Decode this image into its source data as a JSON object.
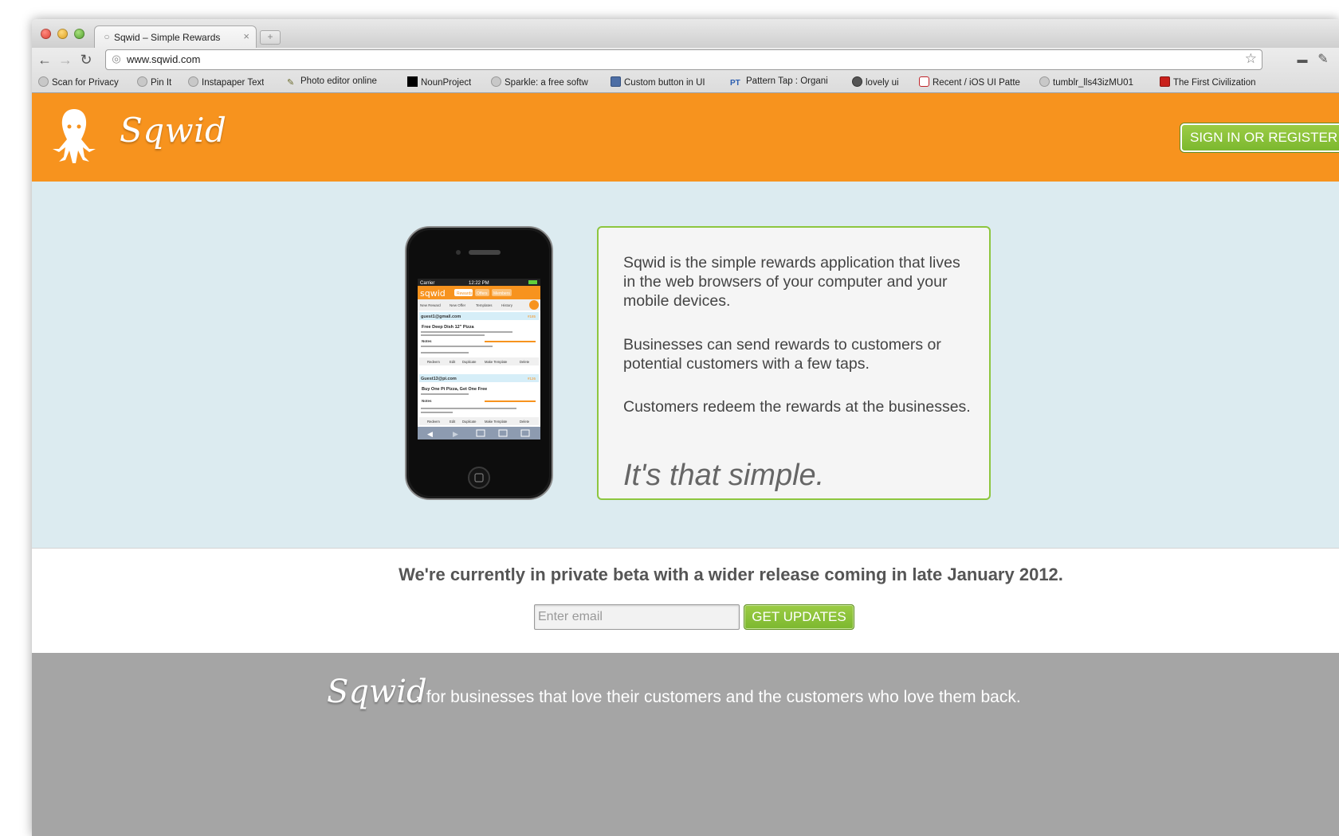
{
  "browser": {
    "tab_title": "Sqwid – Simple Rewards",
    "tab_close": "×",
    "new_tab": "+",
    "url": "www.sqwid.com",
    "bookmarks": [
      {
        "label": "Scan for Privacy",
        "icon": "globe-icon"
      },
      {
        "label": "Pin It",
        "icon": "globe-icon"
      },
      {
        "label": "Instapaper Text",
        "icon": "globe-icon"
      },
      {
        "label": "Photo editor online",
        "icon": "pencil-icon"
      },
      {
        "label": "NounProject",
        "icon": "black-square-icon"
      },
      {
        "label": "Sparkle: a free softw",
        "icon": "globe-icon"
      },
      {
        "label": "Custom button in UI",
        "icon": "image-icon"
      },
      {
        "label": "Pattern Tap : Organi",
        "icon": "pt-icon"
      },
      {
        "label": "lovely ui",
        "icon": "heart-icon"
      },
      {
        "label": "Recent / iOS UI Patte",
        "icon": "pinterest-icon"
      },
      {
        "label": "tumblr_lls43izMU01",
        "icon": "globe-icon"
      },
      {
        "label": "The First Civilization",
        "icon": "mcgraw-icon"
      }
    ]
  },
  "header": {
    "logo_text": "Sqwid",
    "signin_label": "SIGN IN OR REGISTER"
  },
  "hero": {
    "paragraph1": "Sqwid is the simple rewards application that lives in the web browsers of your computer and your mobile devices.",
    "paragraph2": "Businesses can send rewards to customers or potential customers with a few taps.",
    "paragraph3": "Customers redeem the rewards at the businesses.",
    "tagline": "It's that simple.",
    "phone": {
      "carrier": "Carrier",
      "time": "12:22 PM",
      "app_logo": "sqwid",
      "tabs": [
        "Rewards",
        "Offers",
        "Members"
      ],
      "subtabs": [
        "New Reward",
        "New Offer",
        "Templates",
        "History"
      ],
      "cards": [
        {
          "email": "guest1@gmail.com",
          "id": "#185",
          "title": "Free Deep Dish 12\" Pizza",
          "body": "Just present to your server or bartender for a free 12\" deep dish pizza of your choice!",
          "notes_label": "Notes",
          "expires": "Expires 01/13/2012 08:16AM CST",
          "note": "for guest whose pizza was sold on 1/13/12",
          "terms": "Special terms: Just enjoy!",
          "actions": [
            "Redeem",
            "Edit",
            "Duplicate",
            "Make Template",
            "Delete"
          ]
        },
        {
          "email": "Guest13@pi.com",
          "id": "#126",
          "title": "Buy One Pi Pizza, Get One Free",
          "body": "Lesser valued Pi is free.",
          "notes_label": "Notes",
          "expires": "Expires 06/19/2011 10:42AM CST",
          "note": "",
          "terms": "Special terms: No strings attached, though limited to first 50 claimants.",
          "actions": [
            "Redeem",
            "Edit",
            "Duplicate",
            "Make Template",
            "Delete"
          ]
        }
      ]
    }
  },
  "beta": {
    "message": "We're currently in private beta with a wider release coming in late January 2012.",
    "email_placeholder": "Enter email",
    "button_label": "GET UPDATES"
  },
  "footer": {
    "logo_text": "Sqwid",
    "tagline": "- for businesses that love their customers and the customers who love them back."
  },
  "colors": {
    "header_orange": "#f7931e",
    "accent_green": "#8dc63f",
    "hero_bg": "#dcebf0",
    "footer_gray": "#a5a5a5"
  }
}
